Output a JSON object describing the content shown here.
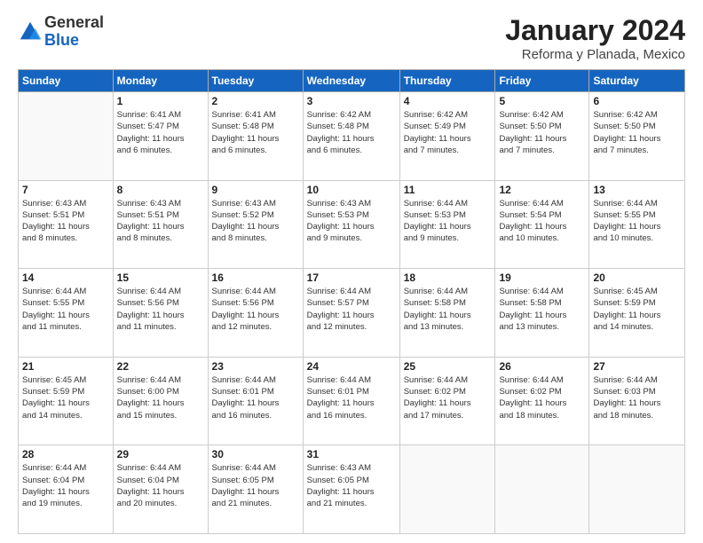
{
  "logo": {
    "general": "General",
    "blue": "Blue"
  },
  "title": "January 2024",
  "location": "Reforma y Planada, Mexico",
  "headers": [
    "Sunday",
    "Monday",
    "Tuesday",
    "Wednesday",
    "Thursday",
    "Friday",
    "Saturday"
  ],
  "weeks": [
    [
      {
        "day": "",
        "info": ""
      },
      {
        "day": "1",
        "info": "Sunrise: 6:41 AM\nSunset: 5:47 PM\nDaylight: 11 hours\nand 6 minutes."
      },
      {
        "day": "2",
        "info": "Sunrise: 6:41 AM\nSunset: 5:48 PM\nDaylight: 11 hours\nand 6 minutes."
      },
      {
        "day": "3",
        "info": "Sunrise: 6:42 AM\nSunset: 5:48 PM\nDaylight: 11 hours\nand 6 minutes."
      },
      {
        "day": "4",
        "info": "Sunrise: 6:42 AM\nSunset: 5:49 PM\nDaylight: 11 hours\nand 7 minutes."
      },
      {
        "day": "5",
        "info": "Sunrise: 6:42 AM\nSunset: 5:50 PM\nDaylight: 11 hours\nand 7 minutes."
      },
      {
        "day": "6",
        "info": "Sunrise: 6:42 AM\nSunset: 5:50 PM\nDaylight: 11 hours\nand 7 minutes."
      }
    ],
    [
      {
        "day": "7",
        "info": "Sunrise: 6:43 AM\nSunset: 5:51 PM\nDaylight: 11 hours\nand 8 minutes."
      },
      {
        "day": "8",
        "info": "Sunrise: 6:43 AM\nSunset: 5:51 PM\nDaylight: 11 hours\nand 8 minutes."
      },
      {
        "day": "9",
        "info": "Sunrise: 6:43 AM\nSunset: 5:52 PM\nDaylight: 11 hours\nand 8 minutes."
      },
      {
        "day": "10",
        "info": "Sunrise: 6:43 AM\nSunset: 5:53 PM\nDaylight: 11 hours\nand 9 minutes."
      },
      {
        "day": "11",
        "info": "Sunrise: 6:44 AM\nSunset: 5:53 PM\nDaylight: 11 hours\nand 9 minutes."
      },
      {
        "day": "12",
        "info": "Sunrise: 6:44 AM\nSunset: 5:54 PM\nDaylight: 11 hours\nand 10 minutes."
      },
      {
        "day": "13",
        "info": "Sunrise: 6:44 AM\nSunset: 5:55 PM\nDaylight: 11 hours\nand 10 minutes."
      }
    ],
    [
      {
        "day": "14",
        "info": "Sunrise: 6:44 AM\nSunset: 5:55 PM\nDaylight: 11 hours\nand 11 minutes."
      },
      {
        "day": "15",
        "info": "Sunrise: 6:44 AM\nSunset: 5:56 PM\nDaylight: 11 hours\nand 11 minutes."
      },
      {
        "day": "16",
        "info": "Sunrise: 6:44 AM\nSunset: 5:56 PM\nDaylight: 11 hours\nand 12 minutes."
      },
      {
        "day": "17",
        "info": "Sunrise: 6:44 AM\nSunset: 5:57 PM\nDaylight: 11 hours\nand 12 minutes."
      },
      {
        "day": "18",
        "info": "Sunrise: 6:44 AM\nSunset: 5:58 PM\nDaylight: 11 hours\nand 13 minutes."
      },
      {
        "day": "19",
        "info": "Sunrise: 6:44 AM\nSunset: 5:58 PM\nDaylight: 11 hours\nand 13 minutes."
      },
      {
        "day": "20",
        "info": "Sunrise: 6:45 AM\nSunset: 5:59 PM\nDaylight: 11 hours\nand 14 minutes."
      }
    ],
    [
      {
        "day": "21",
        "info": "Sunrise: 6:45 AM\nSunset: 5:59 PM\nDaylight: 11 hours\nand 14 minutes."
      },
      {
        "day": "22",
        "info": "Sunrise: 6:44 AM\nSunset: 6:00 PM\nDaylight: 11 hours\nand 15 minutes."
      },
      {
        "day": "23",
        "info": "Sunrise: 6:44 AM\nSunset: 6:01 PM\nDaylight: 11 hours\nand 16 minutes."
      },
      {
        "day": "24",
        "info": "Sunrise: 6:44 AM\nSunset: 6:01 PM\nDaylight: 11 hours\nand 16 minutes."
      },
      {
        "day": "25",
        "info": "Sunrise: 6:44 AM\nSunset: 6:02 PM\nDaylight: 11 hours\nand 17 minutes."
      },
      {
        "day": "26",
        "info": "Sunrise: 6:44 AM\nSunset: 6:02 PM\nDaylight: 11 hours\nand 18 minutes."
      },
      {
        "day": "27",
        "info": "Sunrise: 6:44 AM\nSunset: 6:03 PM\nDaylight: 11 hours\nand 18 minutes."
      }
    ],
    [
      {
        "day": "28",
        "info": "Sunrise: 6:44 AM\nSunset: 6:04 PM\nDaylight: 11 hours\nand 19 minutes."
      },
      {
        "day": "29",
        "info": "Sunrise: 6:44 AM\nSunset: 6:04 PM\nDaylight: 11 hours\nand 20 minutes."
      },
      {
        "day": "30",
        "info": "Sunrise: 6:44 AM\nSunset: 6:05 PM\nDaylight: 11 hours\nand 21 minutes."
      },
      {
        "day": "31",
        "info": "Sunrise: 6:43 AM\nSunset: 6:05 PM\nDaylight: 11 hours\nand 21 minutes."
      },
      {
        "day": "",
        "info": ""
      },
      {
        "day": "",
        "info": ""
      },
      {
        "day": "",
        "info": ""
      }
    ]
  ]
}
